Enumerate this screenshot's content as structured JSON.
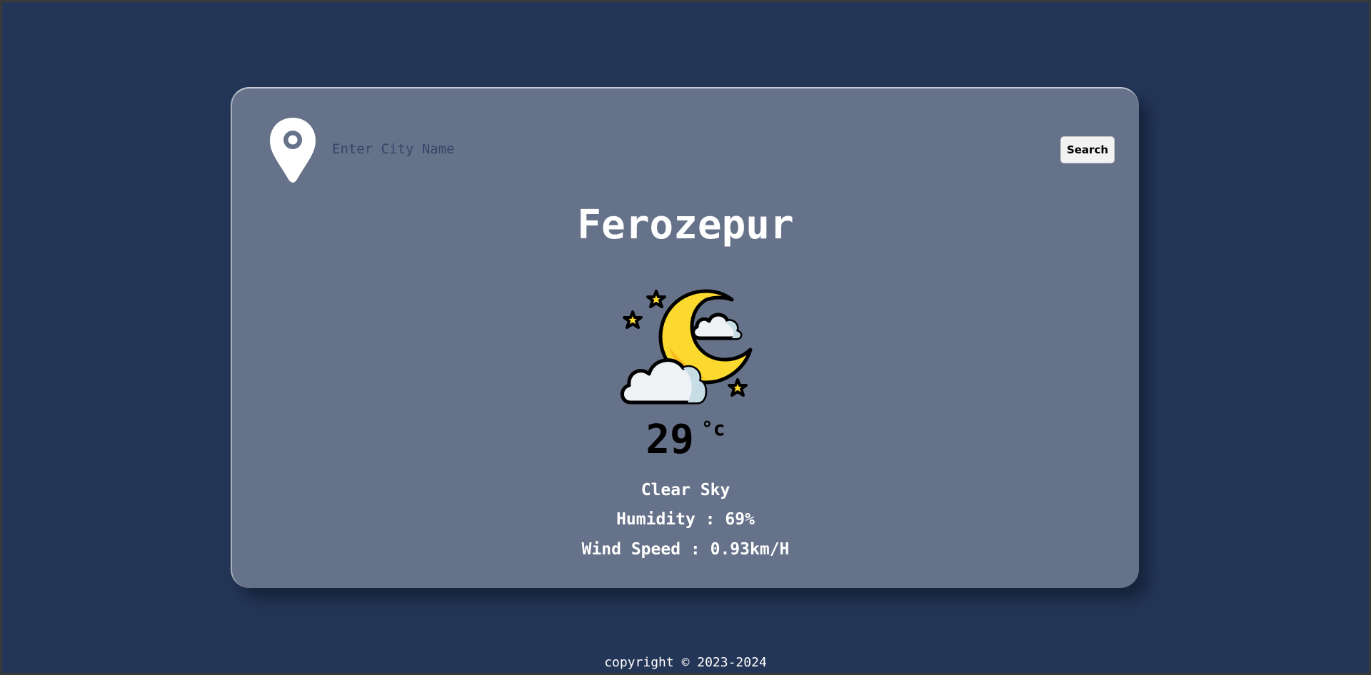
{
  "search": {
    "placeholder": "Enter City Name",
    "value": "",
    "button_label": "Search"
  },
  "weather": {
    "city": "Ferozepur",
    "icon": "moon-clouds-night-icon",
    "temperature": "29",
    "unit": "°c",
    "condition": "Clear Sky",
    "humidity_label": "Humidity : 69%",
    "wind_label": "Wind Speed : 0.93km/H"
  },
  "footer": {
    "copyright": "copyright © 2023-2024"
  },
  "colors": {
    "page_background": "#243657",
    "card_background": "#667289",
    "moon": "#fcd92e",
    "cloud": "#eef2f5"
  }
}
